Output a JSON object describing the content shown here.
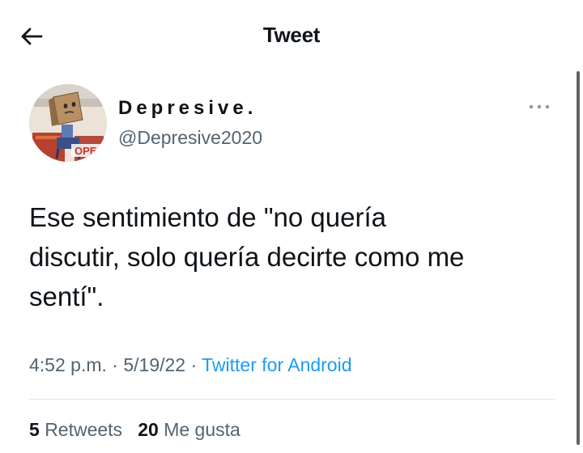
{
  "header": {
    "title": "Tweet",
    "back_icon": "arrow-left-icon"
  },
  "author": {
    "name": "Depresive.",
    "handle": "@Depresive2020",
    "avatar_sign_text": "OPE"
  },
  "tweet": {
    "lines": [
      "Ese sentimiento de \"no quería",
      "discutir, solo quería decirte como me",
      "sentí\"."
    ],
    "time": "4:52 p.m.",
    "separator": "·",
    "date": "5/19/22",
    "source": "Twitter for Android"
  },
  "stats": {
    "retweets_count": "5",
    "retweets_label": "Retweets",
    "likes_count": "20",
    "likes_label": "Me gusta"
  },
  "colors": {
    "link": "#1d9bf0",
    "secondary_text": "#536471",
    "primary_text": "#0f1419",
    "divider": "#dfe3e6"
  }
}
